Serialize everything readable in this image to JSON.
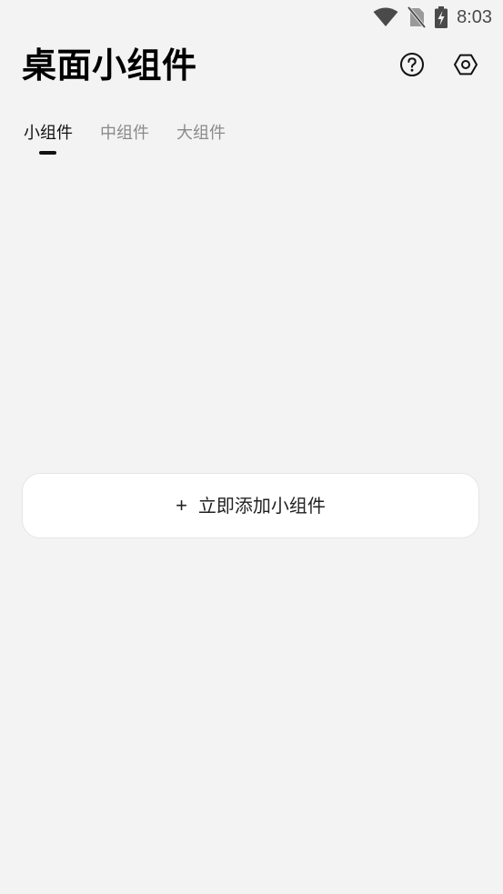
{
  "status_bar": {
    "time": "8:03",
    "icons": [
      "wifi-icon",
      "no-sim-icon",
      "battery-charging-icon"
    ]
  },
  "header": {
    "title": "桌面小组件",
    "help_icon": "help-circle-icon",
    "settings_icon": "hexagon-settings-icon"
  },
  "tabs": [
    {
      "label": "小组件",
      "active": true
    },
    {
      "label": "中组件",
      "active": false
    },
    {
      "label": "大组件",
      "active": false
    }
  ],
  "add_button": {
    "icon_glyph": "+",
    "label": "立即添加小组件"
  },
  "colors": {
    "background": "#f3f3f3",
    "card": "#ffffff",
    "text": "#111111",
    "tab_inactive": "#8a8a8a",
    "status": "#4a4a4a"
  }
}
